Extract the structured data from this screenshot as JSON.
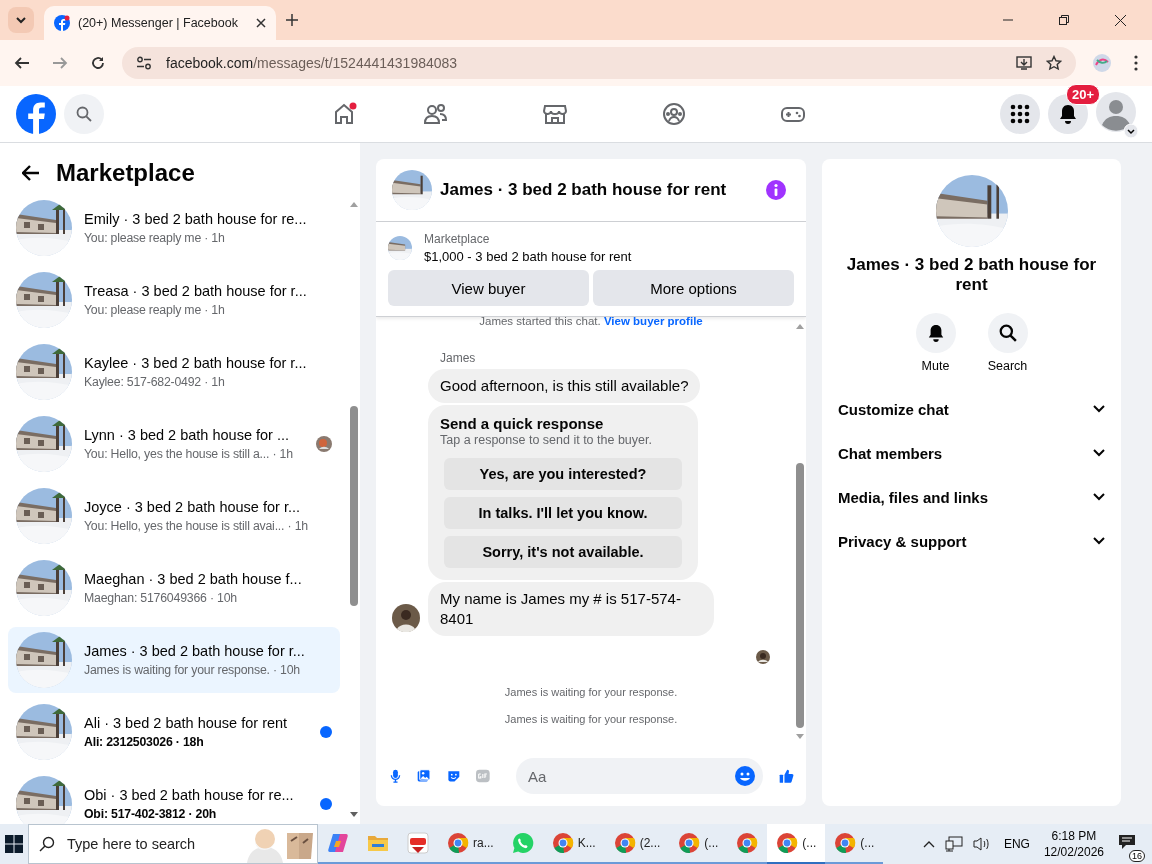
{
  "browser": {
    "tab_title": "(20+) Messenger | Facebook",
    "url_host": "facebook.com",
    "url_path": "/messages/t/1524441431984083"
  },
  "topbar": {
    "nav": [
      {
        "kind": "home",
        "has_dot": true
      },
      {
        "kind": "friends",
        "has_dot": false
      },
      {
        "kind": "marketplace",
        "has_dot": false
      },
      {
        "kind": "groups",
        "has_dot": false
      },
      {
        "kind": "gaming",
        "has_dot": false
      }
    ],
    "notification_badge": "20+"
  },
  "sidebar": {
    "title": "Marketplace",
    "conversations": [
      {
        "title": "Emily · 3 bed 2 bath house for re...",
        "preview": "You: please reaply me · 1h",
        "unread": false,
        "selected": false,
        "seen_avatar": false
      },
      {
        "title": "Treasa · 3 bed 2 bath house for r...",
        "preview": "You: please reaply me · 1h",
        "unread": false,
        "selected": false,
        "seen_avatar": false
      },
      {
        "title": "Kaylee · 3 bed 2 bath house for r...",
        "preview": "Kaylee: 517-682-0492 · 1h",
        "unread": false,
        "selected": false,
        "seen_avatar": false
      },
      {
        "title": "Lynn · 3 bed 2 bath house for ...",
        "preview": "You: Hello, yes the house is still a... · 1h",
        "unread": false,
        "selected": false,
        "seen_avatar": true
      },
      {
        "title": "Joyce · 3 bed 2 bath house for r...",
        "preview": "You: Hello, yes the house is still avai... · 1h",
        "unread": false,
        "selected": false,
        "seen_avatar": false
      },
      {
        "title": "Maeghan · 3 bed 2 bath house f...",
        "preview": "Maeghan: 5176049366 · 10h",
        "unread": false,
        "selected": false,
        "seen_avatar": false
      },
      {
        "title": "James · 3 bed 2 bath house for r...",
        "preview": "James is waiting for your response. · 10h",
        "unread": false,
        "selected": true,
        "seen_avatar": false
      },
      {
        "title": "Ali · 3 bed 2 bath house for rent",
        "preview": "Ali: 2312503026 · 18h",
        "unread": true,
        "selected": false,
        "seen_avatar": false
      },
      {
        "title": "Obi · 3 bed 2 bath house for re...",
        "preview": "Obi: 517-402-3812 · 20h",
        "unread": true,
        "selected": false,
        "seen_avatar": false
      }
    ]
  },
  "chat": {
    "title": "James · 3 bed 2 bath house for rent",
    "listing_label": "Marketplace",
    "listing_title": "$1,000 - 3 bed 2 bath house for rent",
    "buttons": [
      "View buyer",
      "More options"
    ],
    "started_text": "James started this chat.",
    "started_link": "View buyer profile",
    "sender": "James",
    "messages": [
      {
        "kind": "text",
        "text": "Good afternoon, is this still available?",
        "avatar": false
      },
      {
        "kind": "quick_response",
        "title": "Send a quick response",
        "subtitle": "Tap a response to send it to the buyer.",
        "options": [
          "Yes, are you interested?",
          "In talks. I'll let you know.",
          "Sorry, it's not available."
        ]
      },
      {
        "kind": "text",
        "text": "My name is James my # is 517-574-8401",
        "avatar": true
      }
    ],
    "notices": [
      "James is waiting for your response.",
      "James is waiting for your response."
    ],
    "composer_placeholder": "Aa"
  },
  "details": {
    "title": "James · 3 bed 2 bath house for rent",
    "actions": [
      {
        "kind": "mute",
        "label": "Mute"
      },
      {
        "kind": "search",
        "label": "Search"
      }
    ],
    "sections": [
      "Customize chat",
      "Chat members",
      "Media, files and links",
      "Privacy & support"
    ]
  },
  "taskbar": {
    "search_placeholder": "Type here to search",
    "apps": [
      {
        "kind": "copilot",
        "selected": false
      },
      {
        "kind": "folder",
        "selected": false
      },
      {
        "kind": "tube",
        "selected": false
      },
      {
        "kind": "chrome",
        "label": "ra...",
        "selected": false
      },
      {
        "kind": "whatsapp",
        "selected": false
      },
      {
        "kind": "chrome",
        "label": "K...",
        "selected": false
      },
      {
        "kind": "chrome",
        "label": "(2...",
        "selected": false
      },
      {
        "kind": "chrome",
        "label": "(...",
        "selected": false
      },
      {
        "kind": "chrome",
        "selected": false
      },
      {
        "kind": "chrome",
        "label": "(...",
        "selected": true
      },
      {
        "kind": "chrome",
        "label": "(...",
        "selected": false
      }
    ],
    "language": "ENG",
    "time": "6:18 PM",
    "date": "12/02/2026",
    "notification_count": "16"
  }
}
